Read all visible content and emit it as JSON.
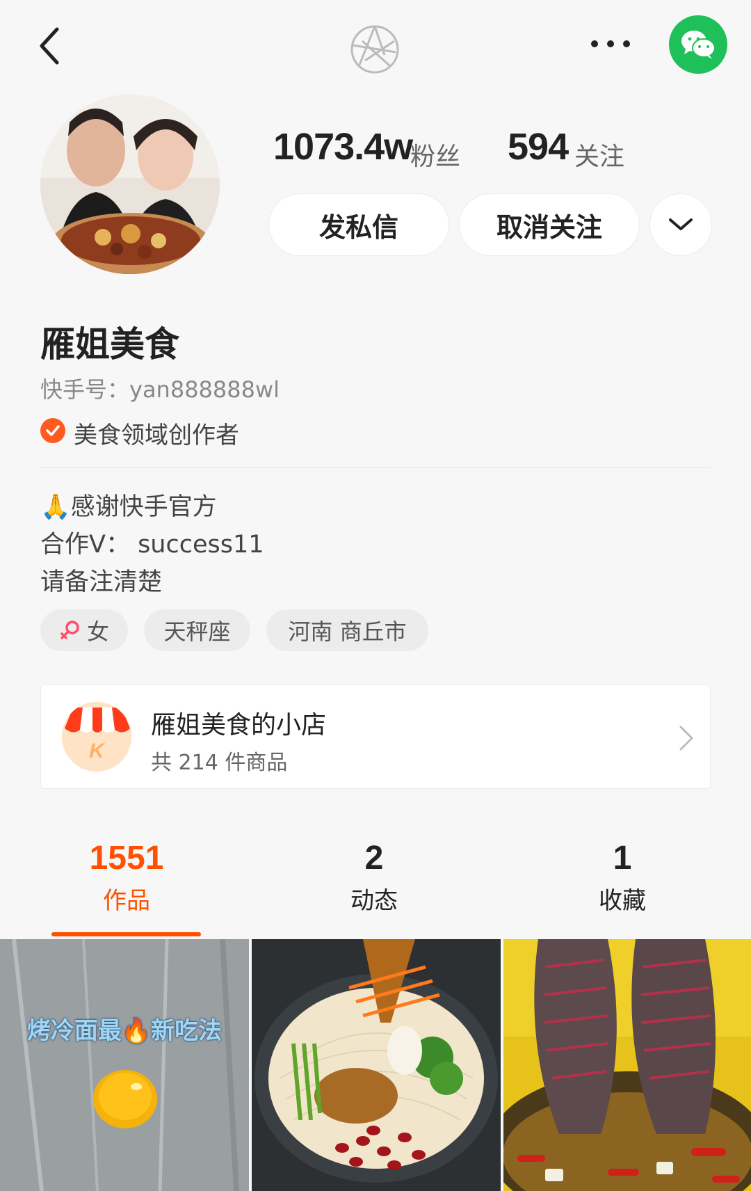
{
  "header": {
    "back_icon": "back-chevron-icon",
    "center_icon": "shutter-icon",
    "more_icon": "more-dots-icon",
    "share_icon": "wechat-icon",
    "wechat_color": "#1fbf5a"
  },
  "profile": {
    "fans_count": "1073.4w",
    "fans_label": "粉丝",
    "following_count": "594",
    "following_label": "关注",
    "message_button": "发私信",
    "unfollow_button": "取消关注",
    "name": "雁姐美食",
    "kwai_id": "快手号：yan888888wl",
    "verify_label": "美食领域创作者",
    "bio": [
      "🙏感谢快手官方",
      "合作V：  success11",
      "请备注清楚"
    ],
    "tags": {
      "gender": "女",
      "zodiac": "天秤座",
      "location": "河南 商丘市"
    }
  },
  "shop": {
    "name": "雁姐美食的小店",
    "count": "共 214 件商品",
    "icon": "shop-icon"
  },
  "tabs": [
    {
      "count": "1551",
      "label": "作品",
      "active": true
    },
    {
      "count": "2",
      "label": "动态",
      "active": false
    },
    {
      "count": "1",
      "label": "收藏",
      "active": false
    }
  ],
  "accent_color": "#ff5000",
  "videos": [
    {
      "caption": "烤冷面最🔥新吃法"
    },
    {
      "caption": ""
    },
    {
      "caption": ""
    }
  ]
}
